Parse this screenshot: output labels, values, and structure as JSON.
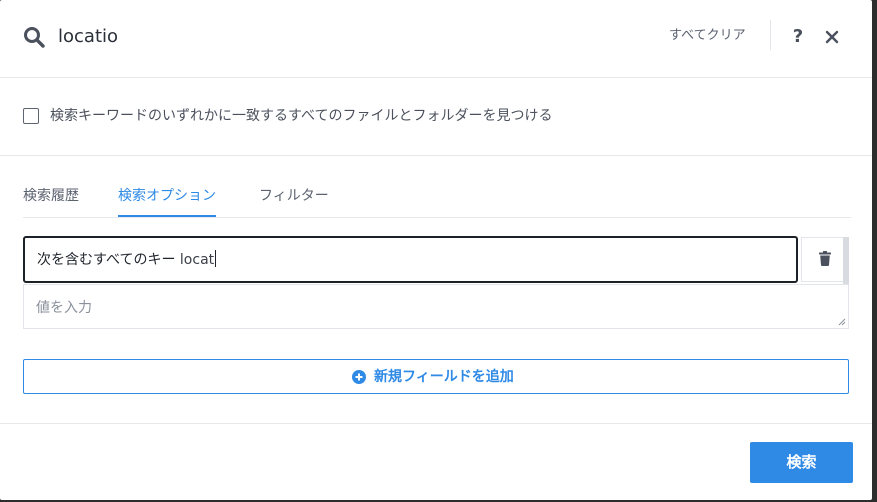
{
  "header": {
    "search_text": "locatio",
    "clear_all_label": "すべてクリア",
    "help_label": "?"
  },
  "option": {
    "checkbox_label": "検索キーワードのいずれかに一致するすべてのファイルとフォルダーを見つける",
    "checked": false
  },
  "tabs": [
    {
      "label": "検索履歴",
      "active": false
    },
    {
      "label": "検索オプション",
      "active": true
    },
    {
      "label": "フィルター",
      "active": false
    }
  ],
  "key_field": {
    "label": "次を含むすべてのキー",
    "value": "locat"
  },
  "value_field": {
    "placeholder": "値を入力"
  },
  "add_field": {
    "label": "新規フィールドを追加"
  },
  "footer": {
    "search_label": "検索"
  },
  "colors": {
    "accent": "#2f8ae6",
    "text_dark": "#1f242c",
    "text_muted": "#5b6270"
  },
  "icons": {
    "search": "search-icon",
    "help": "help-icon",
    "close": "close-icon",
    "trash": "trash-icon",
    "add": "plus-circle-icon"
  }
}
